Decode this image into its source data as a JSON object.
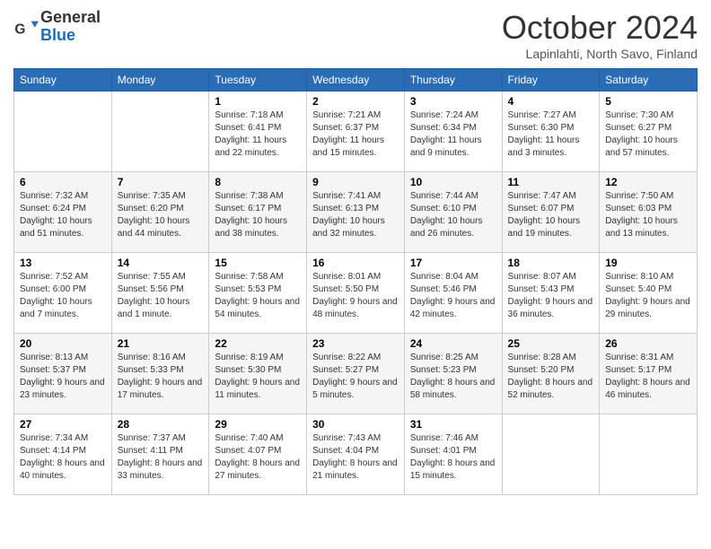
{
  "header": {
    "logo_general": "General",
    "logo_blue": "Blue",
    "month": "October 2024",
    "location": "Lapinlahti, North Savo, Finland"
  },
  "days_of_week": [
    "Sunday",
    "Monday",
    "Tuesday",
    "Wednesday",
    "Thursday",
    "Friday",
    "Saturday"
  ],
  "weeks": [
    [
      {
        "day": "",
        "info": ""
      },
      {
        "day": "",
        "info": ""
      },
      {
        "day": "1",
        "info": "Sunrise: 7:18 AM\nSunset: 6:41 PM\nDaylight: 11 hours and 22 minutes."
      },
      {
        "day": "2",
        "info": "Sunrise: 7:21 AM\nSunset: 6:37 PM\nDaylight: 11 hours and 15 minutes."
      },
      {
        "day": "3",
        "info": "Sunrise: 7:24 AM\nSunset: 6:34 PM\nDaylight: 11 hours and 9 minutes."
      },
      {
        "day": "4",
        "info": "Sunrise: 7:27 AM\nSunset: 6:30 PM\nDaylight: 11 hours and 3 minutes."
      },
      {
        "day": "5",
        "info": "Sunrise: 7:30 AM\nSunset: 6:27 PM\nDaylight: 10 hours and 57 minutes."
      }
    ],
    [
      {
        "day": "6",
        "info": "Sunrise: 7:32 AM\nSunset: 6:24 PM\nDaylight: 10 hours and 51 minutes."
      },
      {
        "day": "7",
        "info": "Sunrise: 7:35 AM\nSunset: 6:20 PM\nDaylight: 10 hours and 44 minutes."
      },
      {
        "day": "8",
        "info": "Sunrise: 7:38 AM\nSunset: 6:17 PM\nDaylight: 10 hours and 38 minutes."
      },
      {
        "day": "9",
        "info": "Sunrise: 7:41 AM\nSunset: 6:13 PM\nDaylight: 10 hours and 32 minutes."
      },
      {
        "day": "10",
        "info": "Sunrise: 7:44 AM\nSunset: 6:10 PM\nDaylight: 10 hours and 26 minutes."
      },
      {
        "day": "11",
        "info": "Sunrise: 7:47 AM\nSunset: 6:07 PM\nDaylight: 10 hours and 19 minutes."
      },
      {
        "day": "12",
        "info": "Sunrise: 7:50 AM\nSunset: 6:03 PM\nDaylight: 10 hours and 13 minutes."
      }
    ],
    [
      {
        "day": "13",
        "info": "Sunrise: 7:52 AM\nSunset: 6:00 PM\nDaylight: 10 hours and 7 minutes."
      },
      {
        "day": "14",
        "info": "Sunrise: 7:55 AM\nSunset: 5:56 PM\nDaylight: 10 hours and 1 minute."
      },
      {
        "day": "15",
        "info": "Sunrise: 7:58 AM\nSunset: 5:53 PM\nDaylight: 9 hours and 54 minutes."
      },
      {
        "day": "16",
        "info": "Sunrise: 8:01 AM\nSunset: 5:50 PM\nDaylight: 9 hours and 48 minutes."
      },
      {
        "day": "17",
        "info": "Sunrise: 8:04 AM\nSunset: 5:46 PM\nDaylight: 9 hours and 42 minutes."
      },
      {
        "day": "18",
        "info": "Sunrise: 8:07 AM\nSunset: 5:43 PM\nDaylight: 9 hours and 36 minutes."
      },
      {
        "day": "19",
        "info": "Sunrise: 8:10 AM\nSunset: 5:40 PM\nDaylight: 9 hours and 29 minutes."
      }
    ],
    [
      {
        "day": "20",
        "info": "Sunrise: 8:13 AM\nSunset: 5:37 PM\nDaylight: 9 hours and 23 minutes."
      },
      {
        "day": "21",
        "info": "Sunrise: 8:16 AM\nSunset: 5:33 PM\nDaylight: 9 hours and 17 minutes."
      },
      {
        "day": "22",
        "info": "Sunrise: 8:19 AM\nSunset: 5:30 PM\nDaylight: 9 hours and 11 minutes."
      },
      {
        "day": "23",
        "info": "Sunrise: 8:22 AM\nSunset: 5:27 PM\nDaylight: 9 hours and 5 minutes."
      },
      {
        "day": "24",
        "info": "Sunrise: 8:25 AM\nSunset: 5:23 PM\nDaylight: 8 hours and 58 minutes."
      },
      {
        "day": "25",
        "info": "Sunrise: 8:28 AM\nSunset: 5:20 PM\nDaylight: 8 hours and 52 minutes."
      },
      {
        "day": "26",
        "info": "Sunrise: 8:31 AM\nSunset: 5:17 PM\nDaylight: 8 hours and 46 minutes."
      }
    ],
    [
      {
        "day": "27",
        "info": "Sunrise: 7:34 AM\nSunset: 4:14 PM\nDaylight: 8 hours and 40 minutes."
      },
      {
        "day": "28",
        "info": "Sunrise: 7:37 AM\nSunset: 4:11 PM\nDaylight: 8 hours and 33 minutes."
      },
      {
        "day": "29",
        "info": "Sunrise: 7:40 AM\nSunset: 4:07 PM\nDaylight: 8 hours and 27 minutes."
      },
      {
        "day": "30",
        "info": "Sunrise: 7:43 AM\nSunset: 4:04 PM\nDaylight: 8 hours and 21 minutes."
      },
      {
        "day": "31",
        "info": "Sunrise: 7:46 AM\nSunset: 4:01 PM\nDaylight: 8 hours and 15 minutes."
      },
      {
        "day": "",
        "info": ""
      },
      {
        "day": "",
        "info": ""
      }
    ]
  ]
}
